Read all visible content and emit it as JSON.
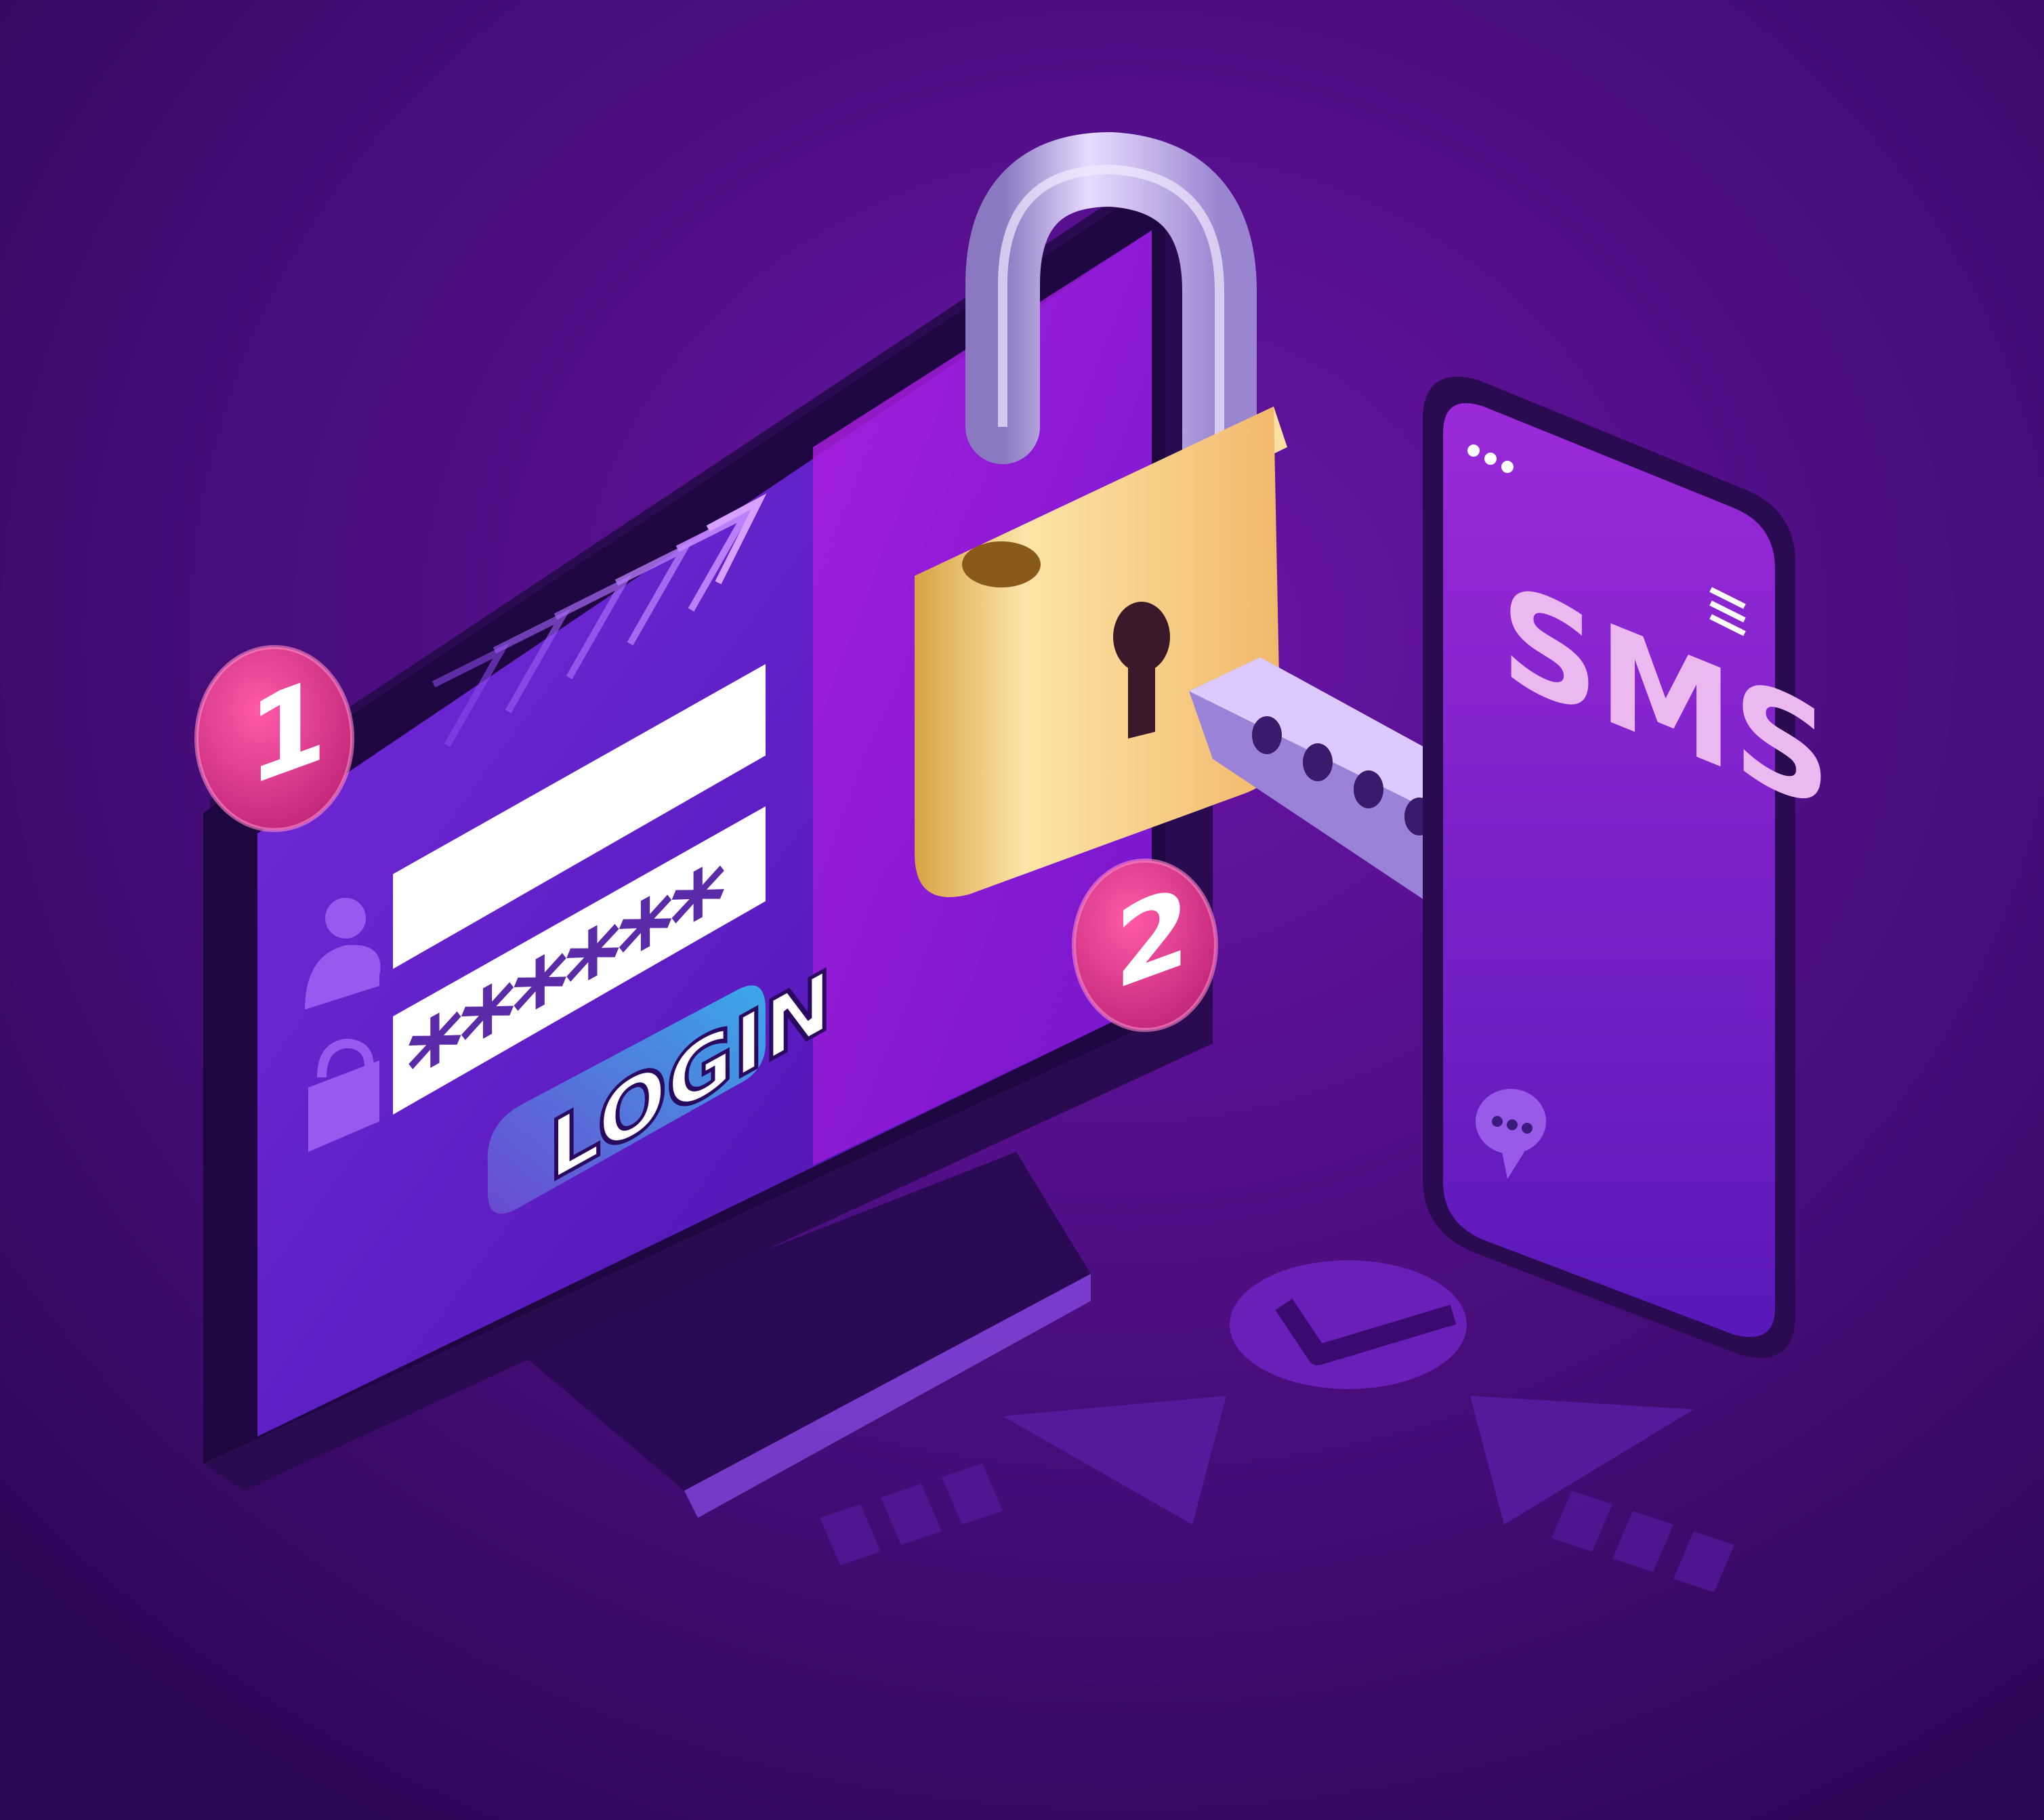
{
  "illustration": {
    "step_badges": [
      {
        "number": "1"
      },
      {
        "number": "2"
      }
    ],
    "login_form": {
      "username_value": "",
      "password_value": "******",
      "login_button_label": "LOGIN"
    },
    "phone": {
      "sms_label": "SMS"
    },
    "colors": {
      "background": "#3a0a66",
      "screen": "#6a1fd0",
      "badge": "#e0378f",
      "lock_body": "#f4c97a",
      "login_button": "#3a9fe0",
      "key": "#c9b4f0"
    },
    "icons": [
      "user-icon",
      "lock-icon",
      "padlock-icon",
      "key-icon",
      "chat-bubble-icon",
      "menu-icon",
      "checkmark-icon",
      "chevron-arrows-icon"
    ]
  }
}
